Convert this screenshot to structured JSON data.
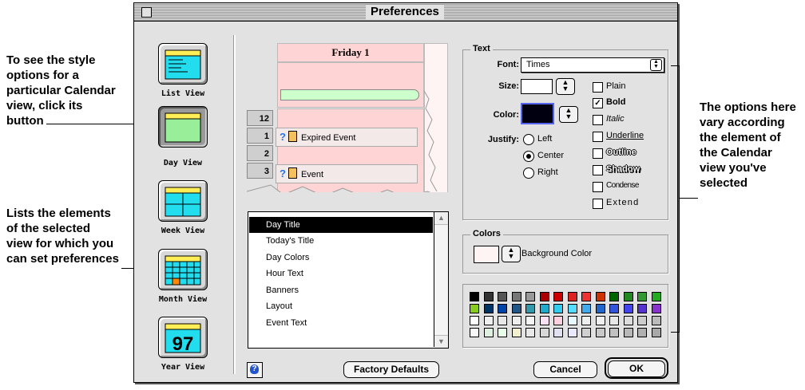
{
  "callouts": {
    "left_top": [
      "To see the style",
      "options for a",
      "particular Calendar",
      "view, click its",
      "button"
    ],
    "left_bottom": [
      "Lists the elements",
      "of the selected",
      "view for which you",
      "can set preferences"
    ],
    "right": [
      "The options here",
      "vary according",
      "the element of",
      "the Calendar",
      "view you've",
      "selected"
    ]
  },
  "window": {
    "title": "Preferences"
  },
  "views": [
    {
      "label": "List View",
      "icon": "list-view-icon",
      "selected": false
    },
    {
      "label": "Day View",
      "icon": "day-view-icon",
      "selected": true
    },
    {
      "label": "Week View",
      "icon": "week-view-icon",
      "selected": false
    },
    {
      "label": "Month View",
      "icon": "month-view-icon",
      "selected": false
    },
    {
      "label": "Year View",
      "icon": "year-view-icon",
      "selected": false
    }
  ],
  "year_icon_number": "97",
  "preview": {
    "day_title": "Friday 1",
    "hours": [
      "12",
      "1",
      "2",
      "3"
    ],
    "events": [
      "Expired Event",
      "Event"
    ],
    "event_marker": "?"
  },
  "elements": {
    "items": [
      "Day Title",
      "Today's Title",
      "Day Colors",
      "Hour Text",
      "Banners",
      "Layout",
      "Event Text"
    ],
    "selected_index": 0
  },
  "text_group": {
    "title": "Text",
    "font_label": "Font:",
    "font_value": "Times",
    "size_label": "Size:",
    "size_value": "",
    "color_label": "Color:",
    "color_value": "#000010",
    "justify_label": "Justify:",
    "justify_options": [
      "Left",
      "Center",
      "Right"
    ],
    "justify_selected": "Center",
    "styles": [
      {
        "label": "Plain",
        "checked": false
      },
      {
        "label": "Bold",
        "checked": true
      },
      {
        "label": "Italic",
        "checked": false
      },
      {
        "label": "Underline",
        "checked": false
      },
      {
        "label": "Outline",
        "checked": false
      },
      {
        "label": "Shadow",
        "checked": false
      },
      {
        "label": "Condense",
        "checked": false
      },
      {
        "label": "Extend",
        "checked": false
      }
    ]
  },
  "colors_group": {
    "title": "Colors",
    "background_label": "Background Color",
    "background_value": "#fff4f4"
  },
  "palette": [
    [
      "#000000",
      "#333333",
      "#555555",
      "#777777",
      "#999999",
      "#aa0000",
      "#cc0000",
      "#dd2222",
      "#ee3333",
      "#cc3300",
      "#006600",
      "#228822",
      "#339933",
      "#22aa22"
    ],
    [
      "#88cc22",
      "#003366",
      "#0044aa",
      "#225588",
      "#3399aa",
      "#22aacc",
      "#33ccee",
      "#55ddff",
      "#44aaee",
      "#2266cc",
      "#3355dd",
      "#4444ee",
      "#5533cc",
      "#8833cc"
    ],
    [
      "#ffffff",
      "#f0f0f0",
      "#e8e8e8",
      "#eeeeee",
      "#f4f4f4",
      "#ffe0f4",
      "#ffd0e0",
      "#e8f8ff",
      "#eeeeee",
      "#f0f0f0",
      "#e8e8e8",
      "#dddddd",
      "#cccccc",
      "#bbbbbb"
    ],
    [
      "#f8f8f8",
      "#e0f0e0",
      "#e8ffe8",
      "#f0f0d0",
      "#e8e8e8",
      "#d8d8d8",
      "#e0e0f0",
      "#e8e8ff",
      "#d0d0d0",
      "#c8c8c8",
      "#c0c0c0",
      "#b8b8b8",
      "#b0b0b0",
      "#a8a8a8"
    ]
  ],
  "buttons": {
    "factory_defaults": "Factory Defaults",
    "cancel": "Cancel",
    "ok": "OK"
  },
  "colors": {
    "accent_blue": "#2277ee",
    "preview_pink": "#ffd4d4",
    "icon_cyan": "#22ddee",
    "icon_yellow": "#ffee55",
    "icon_green": "#99ee99"
  }
}
